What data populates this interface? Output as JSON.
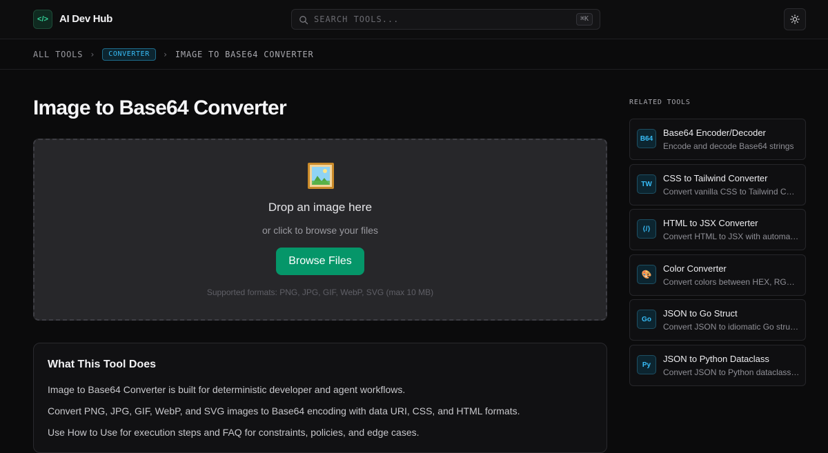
{
  "header": {
    "logo_glyph": "</>",
    "brand": "AI Dev Hub",
    "search": {
      "placeholder": "SEARCH TOOLS...",
      "shortcut": "⌘K"
    },
    "theme_icon": "sun-icon"
  },
  "breadcrumb": {
    "root": "ALL TOOLS",
    "category": "CONVERTER",
    "current": "IMAGE TO BASE64 CONVERTER"
  },
  "main": {
    "title": "Image to Base64 Converter",
    "dropzone": {
      "icon": "framed-picture-icon",
      "title": "Drop an image here",
      "subtitle": "or click to browse your files",
      "button": "Browse Files",
      "formats": "Supported formats: PNG, JPG, GIF, WebP, SVG (max 10 MB)"
    },
    "info": {
      "title": "What This Tool Does",
      "paragraphs": [
        "Image to Base64 Converter is built for deterministic developer and agent workflows.",
        "Convert PNG, JPG, GIF, WebP, and SVG images to Base64 encoding with data URI, CSS, and HTML formats.",
        "Use How to Use for execution steps and FAQ for constraints, policies, and edge cases."
      ]
    }
  },
  "related": {
    "heading": "RELATED TOOLS",
    "tools": [
      {
        "icon": "B64",
        "name": "Base64 Encoder/Decoder",
        "desc": "Encode and decode Base64 strings"
      },
      {
        "icon": "TW",
        "name": "CSS to Tailwind Converter",
        "desc": "Convert vanilla CSS to Tailwind CSS classes"
      },
      {
        "icon": "⟨/⟩",
        "name": "HTML to JSX Converter",
        "desc": "Convert HTML to JSX with automatic attribute conversion"
      },
      {
        "icon": "🎨",
        "name": "Color Converter",
        "desc": "Convert colors between HEX, RGB, HSL"
      },
      {
        "icon": "Go",
        "name": "JSON to Go Struct",
        "desc": "Convert JSON to idiomatic Go struct definitions"
      },
      {
        "icon": "Py",
        "name": "JSON to Python Dataclass",
        "desc": "Convert JSON to Python dataclass definitions"
      }
    ]
  },
  "colors": {
    "accent_green": "#059669",
    "accent_blue": "#38bdf8",
    "background": "#0b0b0c"
  }
}
